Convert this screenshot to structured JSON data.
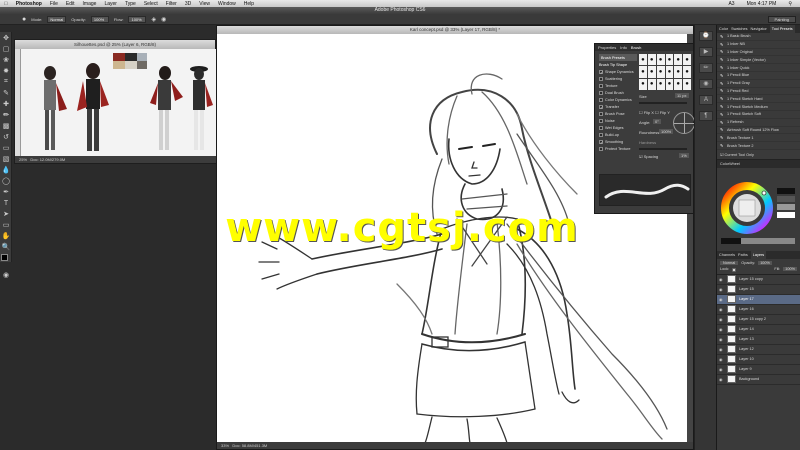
{
  "menubar": {
    "app": "Photoshop",
    "items": [
      "File",
      "Edit",
      "Image",
      "Layer",
      "Type",
      "Select",
      "Filter",
      "3D",
      "View",
      "Window",
      "Help"
    ],
    "status": [
      "A3",
      "Mon 4:17 PM"
    ]
  },
  "window_title": "Adobe Photoshop CS6",
  "options_bar": {
    "mode_label": "Mode:",
    "mode_value": "Normal",
    "opacity_label": "Opacity:",
    "opacity_value": "100%",
    "flow_label": "Flow:",
    "flow_value": "100%",
    "workspace": "Painting"
  },
  "doc1": {
    "title": "Silhouettes.psd @ 25% (Layer 6, RGB/8)",
    "zoom": "25%",
    "status": "Doc: 12.0M/279.0M",
    "palette_colors": [
      "#8a2a22",
      "#2a2a2a",
      "#cdb68f",
      "#d7d2c7",
      "#6f6a64",
      "#a8b0b8"
    ]
  },
  "doc2": {
    "title": "Karl concept.psd @ 33% (Layer 17, RGB/8) *",
    "zoom": "33%",
    "status": "Doc: 58.8M/451.3M"
  },
  "brush_panel": {
    "tabs": [
      "Properties",
      "Info",
      "Brush"
    ],
    "preset_button": "Brush Presets",
    "items": [
      {
        "label": "Brush Tip Shape",
        "checked": false,
        "head": true
      },
      {
        "label": "Shape Dynamics",
        "checked": true
      },
      {
        "label": "Scattering",
        "checked": false
      },
      {
        "label": "Texture",
        "checked": false
      },
      {
        "label": "Dual Brush",
        "checked": false
      },
      {
        "label": "Color Dynamics",
        "checked": false
      },
      {
        "label": "Transfer",
        "checked": true
      },
      {
        "label": "Brush Pose",
        "checked": false
      },
      {
        "label": "Noise",
        "checked": false
      },
      {
        "label": "Wet Edges",
        "checked": false
      },
      {
        "label": "Build-up",
        "checked": false
      },
      {
        "label": "Smoothing",
        "checked": true
      },
      {
        "label": "Protect Texture",
        "checked": false
      }
    ],
    "size_label": "Size",
    "size_value": "11 px",
    "flip_x": "Flip X",
    "flip_y": "Flip Y",
    "angle_label": "Angle:",
    "angle_value": "0°",
    "roundness_label": "Roundness:",
    "roundness_value": "100%",
    "hardness_label": "Hardness",
    "spacing_label": "Spacing",
    "spacing_value": "1%",
    "tip_sizes": [
      "30",
      "30",
      "30",
      "25",
      "25",
      "25",
      "36",
      "25",
      "36",
      "36",
      "32",
      "25",
      "14",
      "24",
      "27",
      "39",
      "46",
      "59"
    ]
  },
  "right_panel": {
    "tabs": [
      "Color",
      "Swatches",
      "Navigator",
      "Tool Presets"
    ],
    "presets": [
      "1 Basic Brush",
      "1 Inker NB",
      "1 Inker Original",
      "1 Inker Simple (Vector)",
      "1 Inker Quick",
      "1 Pencil Blue",
      "1 Pencil Gray",
      "1 Pencil Red",
      "1 Pencil Sketch Hard",
      "1 Pencil Sketch Medium",
      "1 Pencil Sketch Soft",
      "1 Refresh",
      "Airbrush Soft Round 12% Flow",
      "Brush Texture 1",
      "Brush Texture 2"
    ],
    "current_tool_only": "Current Tool Only",
    "section2": "ColorWheel",
    "layer_tabs": [
      "Channels",
      "Paths",
      "Layers"
    ],
    "blend_mode": "Normal",
    "opacity_label": "Opacity:",
    "opacity_value": "100%",
    "fill_label": "Fill:",
    "fill_value": "100%",
    "lock_label": "Lock:",
    "layers": [
      {
        "name": "Layer 15 copy",
        "selected": false
      },
      {
        "name": "Layer 15",
        "selected": false
      },
      {
        "name": "Layer 17",
        "selected": true
      },
      {
        "name": "Layer 16",
        "selected": false
      },
      {
        "name": "Layer 15 copy 2",
        "selected": false
      },
      {
        "name": "Layer 14",
        "selected": false
      },
      {
        "name": "Layer 13",
        "selected": false
      },
      {
        "name": "Layer 12",
        "selected": false
      },
      {
        "name": "Layer 10",
        "selected": false
      },
      {
        "name": "Layer 9",
        "selected": false
      },
      {
        "name": "Background",
        "selected": false
      }
    ]
  },
  "watermark": "www.cgtsj.com"
}
